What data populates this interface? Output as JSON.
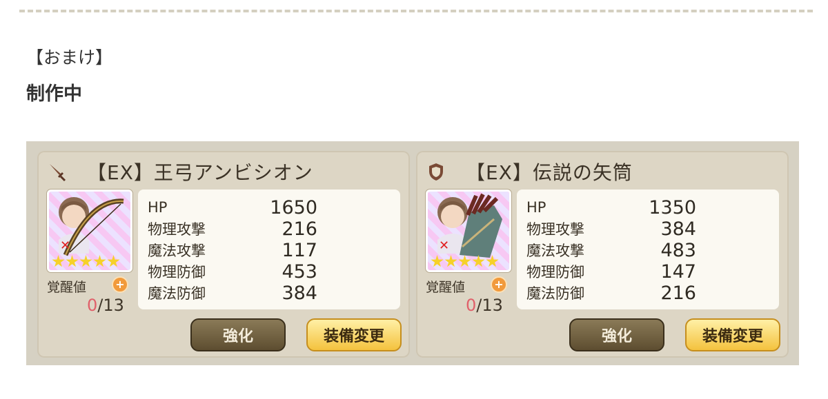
{
  "article": {
    "bracket_heading": "【おまけ】",
    "bold_heading": "制作中"
  },
  "cards": [
    {
      "title": "【EX】王弓アンビシオン",
      "icon": "sword-icon",
      "stats": [
        {
          "label": "HP",
          "value": "1650"
        },
        {
          "label": "物理攻撃",
          "value": "216"
        },
        {
          "label": "魔法攻撃",
          "value": "117"
        },
        {
          "label": "物理防御",
          "value": "453"
        },
        {
          "label": "魔法防御",
          "value": "384"
        }
      ],
      "stars": 5,
      "awakening_label": "覚醒値",
      "awakening_current": "0",
      "awakening_max": "/13",
      "strengthen_label": "強化",
      "change_label": "装備変更"
    },
    {
      "title": "【EX】伝説の矢筒",
      "icon": "shield-icon",
      "stats": [
        {
          "label": "HP",
          "value": "1350"
        },
        {
          "label": "物理攻撃",
          "value": "384"
        },
        {
          "label": "魔法攻撃",
          "value": "483"
        },
        {
          "label": "物理防御",
          "value": "147"
        },
        {
          "label": "魔法防御",
          "value": "216"
        }
      ],
      "stars": 5,
      "awakening_label": "覚醒値",
      "awakening_current": "0",
      "awakening_max": "/13",
      "strengthen_label": "強化",
      "change_label": "装備変更"
    }
  ],
  "colors": {
    "star": "#f6d12a",
    "awakening_zero": "#e0606a",
    "strengthen_button": "#5d4d30",
    "change_button": "#f4c23e"
  }
}
